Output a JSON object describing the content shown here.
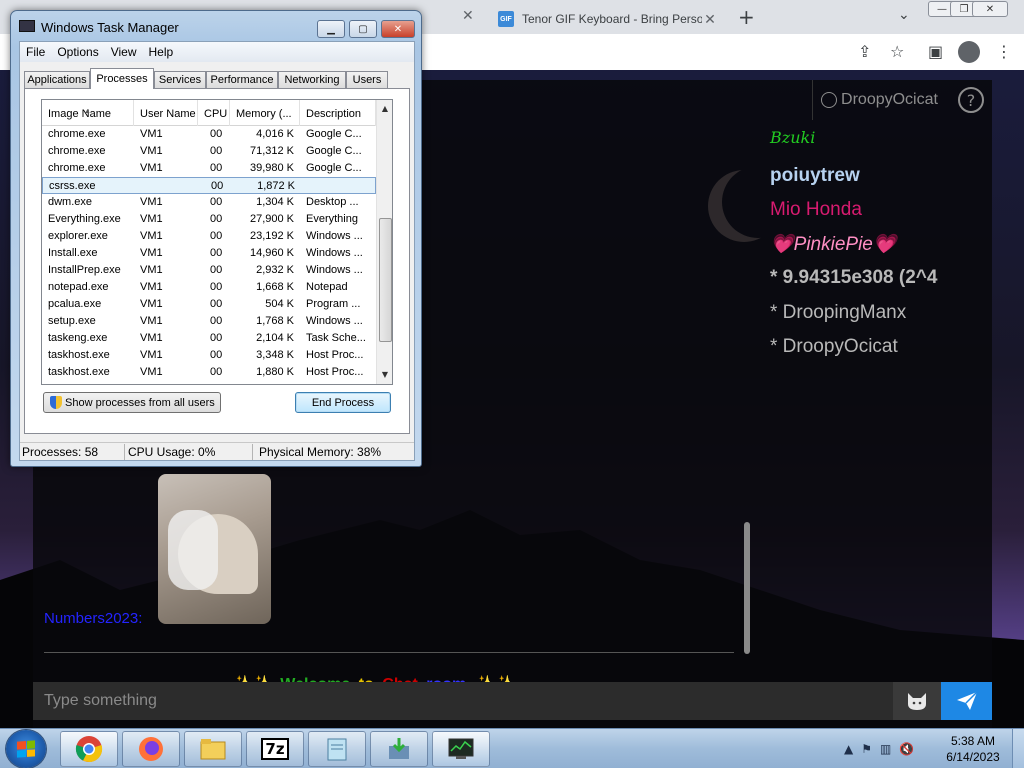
{
  "browser": {
    "tabs": [
      {
        "title": "Tenor GIF Keyboard - Bring Personality",
        "favicon": "GIF"
      }
    ],
    "new_tab_symbol": "+",
    "close_symbol": "✕"
  },
  "chat": {
    "current_user": "DroopyOcicat",
    "help_symbol": "?",
    "online_users": [
      {
        "name": "Bzuki",
        "color": "#22cc22"
      },
      {
        "name": "poiuytrew",
        "color": "#b7d2f0"
      },
      {
        "name": "Mio Honda",
        "color": "#d81b70"
      },
      {
        "name": "💗PinkiePie💗",
        "color": "#ff8fc4"
      },
      {
        "name": "* 9.94315e308 (2^4",
        "color": "#b9b9b9"
      },
      {
        "name": "* DroopingManx",
        "color": "#b9b9b9"
      },
      {
        "name": "* DroopyOcicat",
        "color": "#b9b9b9"
      }
    ],
    "message_author": "Numbers2023:",
    "welcome_parts": [
      {
        "text": "✨✨",
        "color": "#ffffff"
      },
      {
        "text": "Welcome",
        "color": "#22aa22"
      },
      {
        "text": "to",
        "color": "#e6c200"
      },
      {
        "text": "Chat",
        "color": "#cc0000"
      },
      {
        "text": "room",
        "color": "#3333ff"
      },
      {
        "text": "✨✨",
        "color": "#ffffff"
      }
    ],
    "input_placeholder": "Type something",
    "accent": "#1e88e5"
  },
  "taskmgr": {
    "title": "Windows Task Manager",
    "menus": [
      "File",
      "Options",
      "View",
      "Help"
    ],
    "tabs": [
      "Applications",
      "Processes",
      "Services",
      "Performance",
      "Networking",
      "Users"
    ],
    "active_tab": "Processes",
    "columns": [
      "Image Name",
      "User Name",
      "CPU",
      "Memory (...",
      "Description"
    ],
    "processes": [
      {
        "name": "chrome.exe",
        "user": "VM1",
        "cpu": "00",
        "mem": "4,016 K",
        "desc": "Google C..."
      },
      {
        "name": "chrome.exe",
        "user": "VM1",
        "cpu": "00",
        "mem": "71,312 K",
        "desc": "Google C..."
      },
      {
        "name": "chrome.exe",
        "user": "VM1",
        "cpu": "00",
        "mem": "39,980 K",
        "desc": "Google C..."
      },
      {
        "name": "csrss.exe",
        "user": "",
        "cpu": "00",
        "mem": "1,872 K",
        "desc": "",
        "selected": true
      },
      {
        "name": "dwm.exe",
        "user": "VM1",
        "cpu": "00",
        "mem": "1,304 K",
        "desc": "Desktop ..."
      },
      {
        "name": "Everything.exe",
        "user": "VM1",
        "cpu": "00",
        "mem": "27,900 K",
        "desc": "Everything"
      },
      {
        "name": "explorer.exe",
        "user": "VM1",
        "cpu": "00",
        "mem": "23,192 K",
        "desc": "Windows ..."
      },
      {
        "name": "Install.exe",
        "user": "VM1",
        "cpu": "00",
        "mem": "14,960 K",
        "desc": "Windows ..."
      },
      {
        "name": "InstallPrep.exe",
        "user": "VM1",
        "cpu": "00",
        "mem": "2,932 K",
        "desc": "Windows ..."
      },
      {
        "name": "notepad.exe",
        "user": "VM1",
        "cpu": "00",
        "mem": "1,668 K",
        "desc": "Notepad"
      },
      {
        "name": "pcalua.exe",
        "user": "VM1",
        "cpu": "00",
        "mem": "504 K",
        "desc": "Program ..."
      },
      {
        "name": "setup.exe",
        "user": "VM1",
        "cpu": "00",
        "mem": "1,768 K",
        "desc": "Windows ..."
      },
      {
        "name": "taskeng.exe",
        "user": "VM1",
        "cpu": "00",
        "mem": "2,104 K",
        "desc": "Task Sche..."
      },
      {
        "name": "taskhost.exe",
        "user": "VM1",
        "cpu": "00",
        "mem": "3,348 K",
        "desc": "Host Proc..."
      },
      {
        "name": "taskhost.exe",
        "user": "VM1",
        "cpu": "00",
        "mem": "1,880 K",
        "desc": "Host Proc..."
      }
    ],
    "show_all_label": "Show processes from all users",
    "end_process_label": "End Process",
    "status": {
      "processes": "Processes: 58",
      "cpu": "CPU Usage: 0%",
      "memory": "Physical Memory: 38%"
    }
  },
  "taskbar": {
    "apps": [
      {
        "name": "chrome",
        "active": true
      },
      {
        "name": "firefox",
        "active": false
      },
      {
        "name": "explorer",
        "active": false
      },
      {
        "name": "7zip",
        "label": "7z",
        "active": false
      },
      {
        "name": "notepad",
        "active": false
      },
      {
        "name": "installer",
        "active": false
      },
      {
        "name": "task-manager",
        "active": true
      }
    ],
    "time": "5:38 AM",
    "date": "6/14/2023"
  }
}
